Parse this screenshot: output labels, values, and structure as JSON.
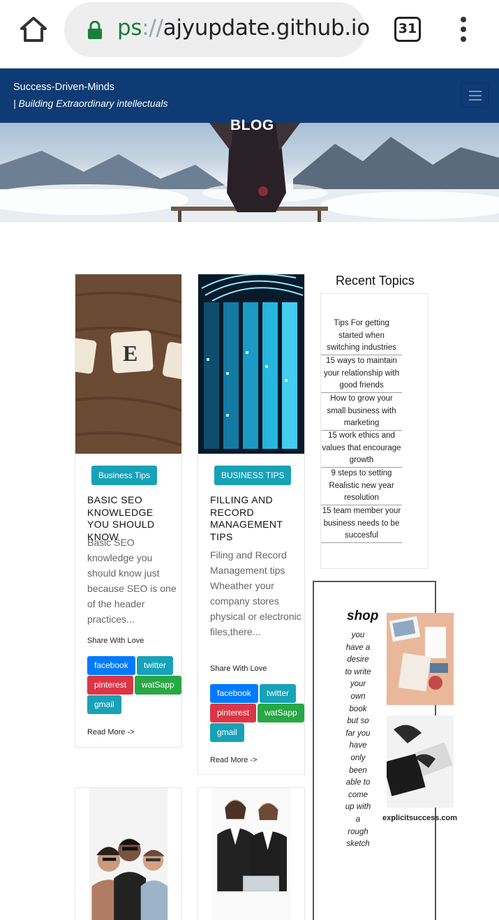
{
  "browser": {
    "url_scheme": "ps",
    "url_sep": "://",
    "url_host": "ajyupdate.github.io",
    "tab_count": "31"
  },
  "navbar": {
    "brand": "Success-Driven-Minds",
    "tagline": "| Building Extraordinary intellectuals"
  },
  "hero": {
    "title": "BLOG"
  },
  "cards": [
    {
      "category": "Business Tips",
      "title": "BASIC SEO KNOWLEDGE YOU SHOULD KNOW",
      "excerpt": "Basic SEO knowledge you should know just because SEO is one of the header practices...",
      "share_label": "Share With Love",
      "share": {
        "facebook": "facebook",
        "twitter": "twitter",
        "pinterest": "pinterest",
        "whatsapp": "watSapp",
        "gmail": "gmail"
      },
      "read_more": "Read More ->"
    },
    {
      "category": "BUSINESS TIPS",
      "title": "FILLING AND RECORD MANAGEMENT TIPS",
      "excerpt": "Filing and Record Management tips Wheather your company stores physical or electronic files,there...",
      "share_label": "Share With Love",
      "share": {
        "facebook": "facebook",
        "twitter": "twitter",
        "pinterest": "pinterest",
        "whatsapp": "watSapp",
        "gmail": "gmail"
      },
      "read_more": "Read More ->"
    }
  ],
  "recent": {
    "title": "Recent Topics",
    "items": [
      "Tips For getting started when switching industries",
      "15 ways to maintain your relationship with good friends",
      "How to grow your small business with marketing",
      "15 work ethics and values that encourage growth",
      "9 steps to setting Realistic new year resolution",
      "15 team member your business needs to be succesful"
    ]
  },
  "shop": {
    "title": "shop",
    "text": "you have a desire to write your own book but so far you have only been able to come up with a rough sketch",
    "site": "explicitsuccess.com"
  },
  "colors": {
    "navbar": "#0e3b73",
    "badge": "#17a2b8",
    "facebook": "#007bff",
    "pinterest": "#dc3545",
    "whatsapp": "#28a745"
  }
}
